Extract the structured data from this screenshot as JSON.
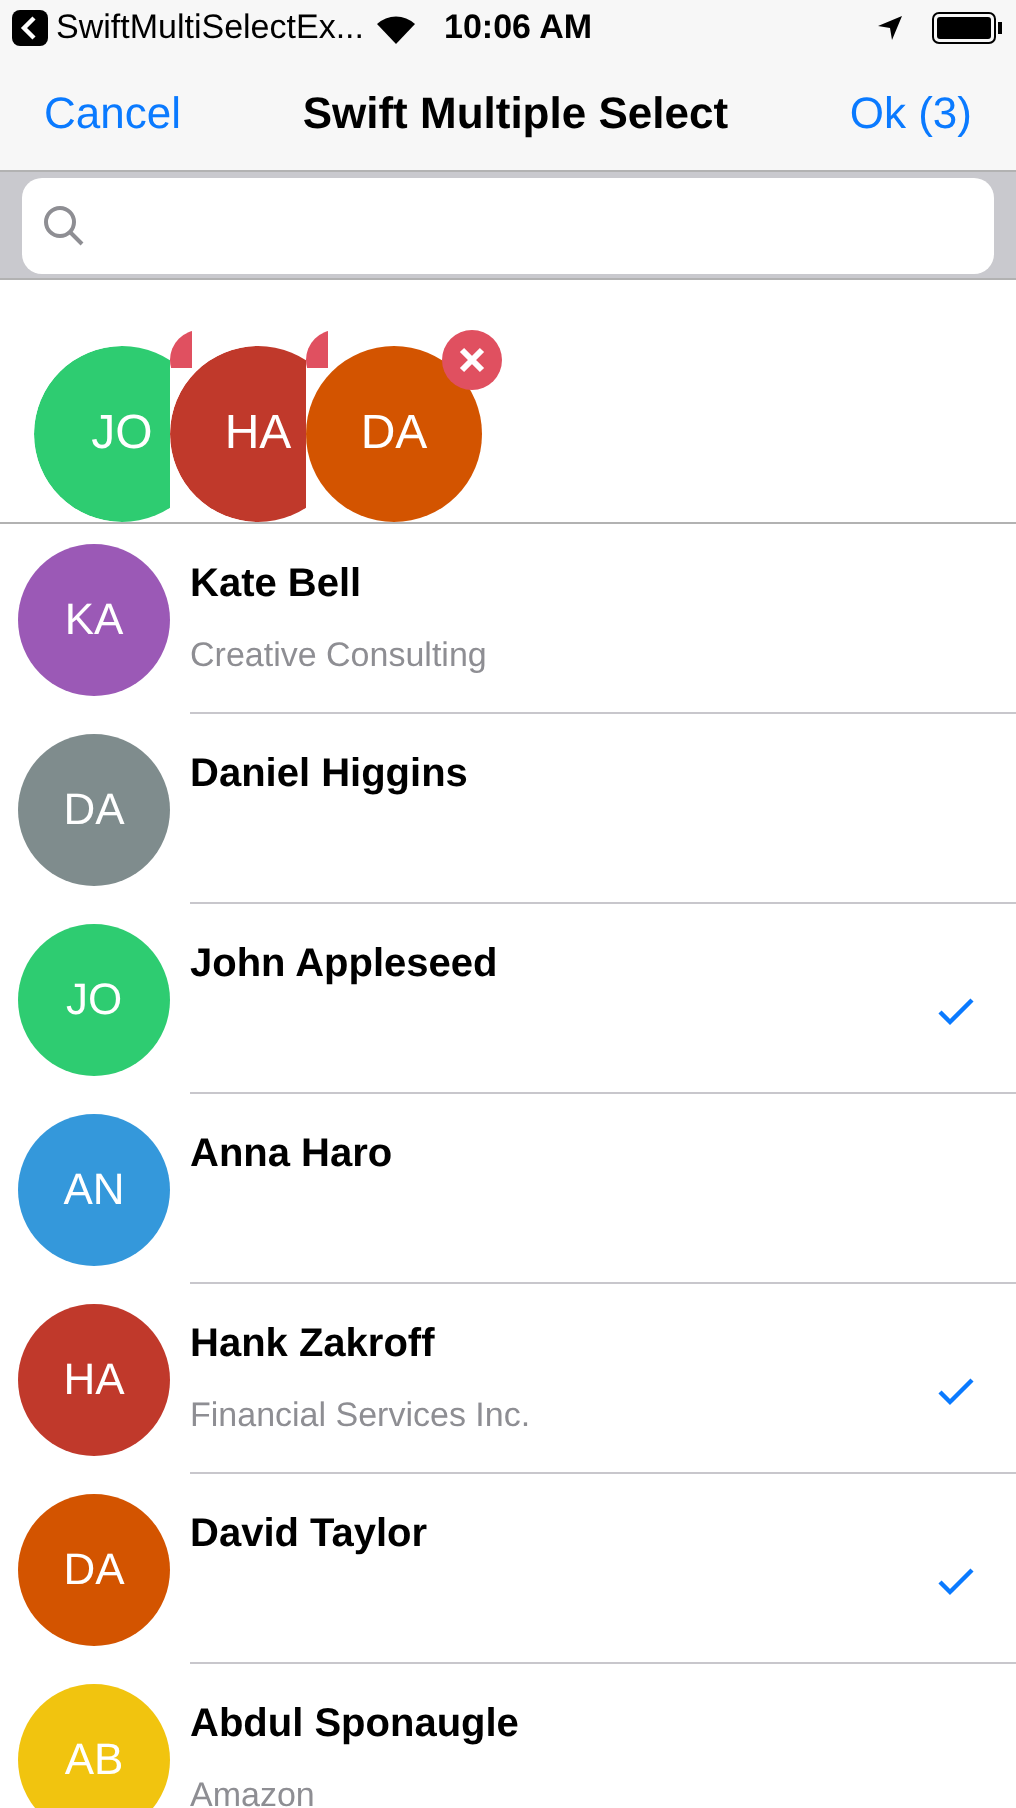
{
  "status_bar": {
    "back_app": "SwiftMultiSelectEx...",
    "time": "10:06 AM"
  },
  "nav": {
    "cancel": "Cancel",
    "title": "Swift Multiple Select",
    "ok": "Ok (3)"
  },
  "selected_chips": [
    {
      "initials": "JO",
      "color": "#2ecc71"
    },
    {
      "initials": "HA",
      "color": "#c0392b"
    },
    {
      "initials": "DA",
      "color": "#d35400"
    }
  ],
  "contacts": [
    {
      "initials": "KA",
      "name": "Kate Bell",
      "subtitle": "Creative Consulting",
      "color": "#9b59b6",
      "selected": false
    },
    {
      "initials": "DA",
      "name": "Daniel Higgins",
      "color": "#7f8c8d",
      "selected": false
    },
    {
      "initials": "JO",
      "name": "John Appleseed",
      "color": "#2ecc71",
      "selected": true
    },
    {
      "initials": "AN",
      "name": "Anna Haro",
      "color": "#3498db",
      "selected": false
    },
    {
      "initials": "HA",
      "name": "Hank Zakroff",
      "subtitle": "Financial Services Inc.",
      "color": "#c0392b",
      "selected": true
    },
    {
      "initials": "DA",
      "name": "David Taylor",
      "color": "#d35400",
      "selected": true
    },
    {
      "initials": "AB",
      "name": "Abdul Sponaugle",
      "subtitle": "Amazon",
      "color": "#f1c40f",
      "selected": false
    }
  ]
}
